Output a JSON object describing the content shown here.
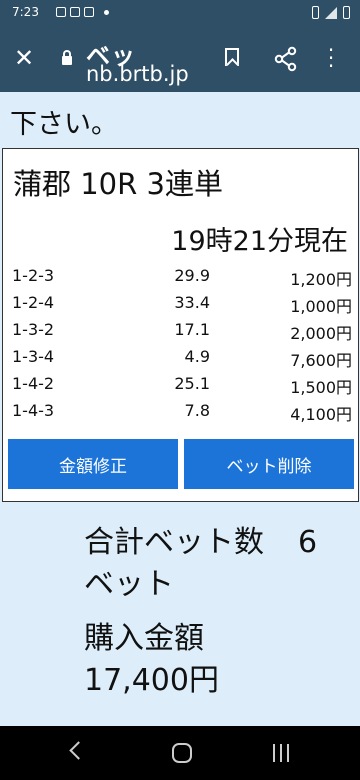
{
  "status_bar": {
    "time": "7:23"
  },
  "browser": {
    "page_title": "ベッ",
    "url": "nb.brtb.jp"
  },
  "page": {
    "top_text": "下さい。"
  },
  "bet_card": {
    "race": "蒲郡 10R 3連単",
    "as_of": "19時21分現在",
    "rows": [
      {
        "combo": "1-2-3",
        "odds": "29.9",
        "amount": "1,200円"
      },
      {
        "combo": "1-2-4",
        "odds": "33.4",
        "amount": "1,000円"
      },
      {
        "combo": "1-3-2",
        "odds": "17.1",
        "amount": "2,000円"
      },
      {
        "combo": "1-3-4",
        "odds": "4.9",
        "amount": "7,600円"
      },
      {
        "combo": "1-4-2",
        "odds": "25.1",
        "amount": "1,500円"
      },
      {
        "combo": "1-4-3",
        "odds": "7.8",
        "amount": "4,100円"
      }
    ],
    "edit_button": "金額修正",
    "delete_button": "ベット削除"
  },
  "summary": {
    "total_bets_label": "合計ベット数",
    "total_bets_value": "6",
    "total_bets_unit": "ベット",
    "purchase_label": "購入金額",
    "purchase_value": "17,400円"
  },
  "colors": {
    "toolbar_bg": "#2f4f66",
    "page_bg": "#ddeefa",
    "button_bg": "#1c74d9"
  }
}
